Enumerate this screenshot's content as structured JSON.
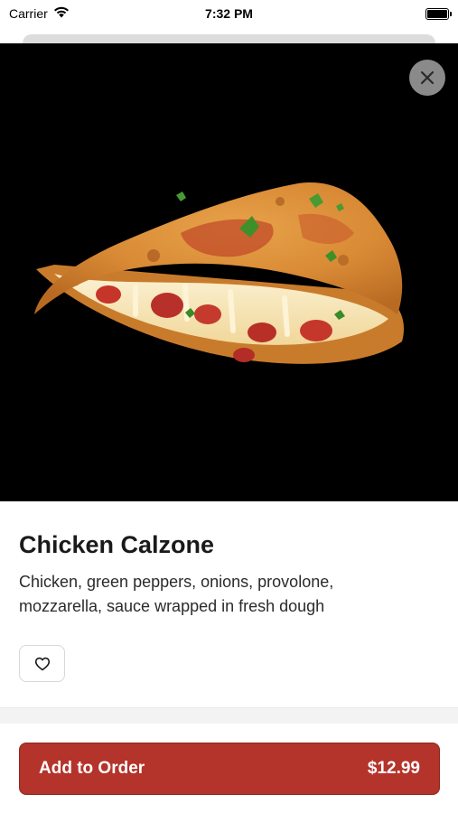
{
  "status_bar": {
    "carrier": "Carrier",
    "time": "7:32 PM"
  },
  "product": {
    "name": "Chicken Calzone",
    "description": "Chicken, green peppers, onions, provolone, mozzarella, sauce wrapped in fresh dough",
    "image_alt": "calzone-photo"
  },
  "actions": {
    "add_label": "Add to Order",
    "price": "$12.99"
  },
  "colors": {
    "accent": "#b4332a",
    "hero_background": "#000000"
  },
  "icons": {
    "close": "close-icon",
    "favorite": "heart-icon",
    "wifi": "wifi-icon",
    "battery": "battery-icon"
  }
}
